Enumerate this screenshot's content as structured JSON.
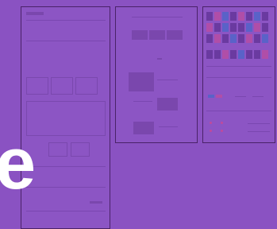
{
  "overlay": {
    "glyph": "e"
  },
  "panels": [
    {
      "name": "mockup-page-1"
    },
    {
      "name": "mockup-page-2"
    },
    {
      "name": "mockup-page-3"
    }
  ]
}
